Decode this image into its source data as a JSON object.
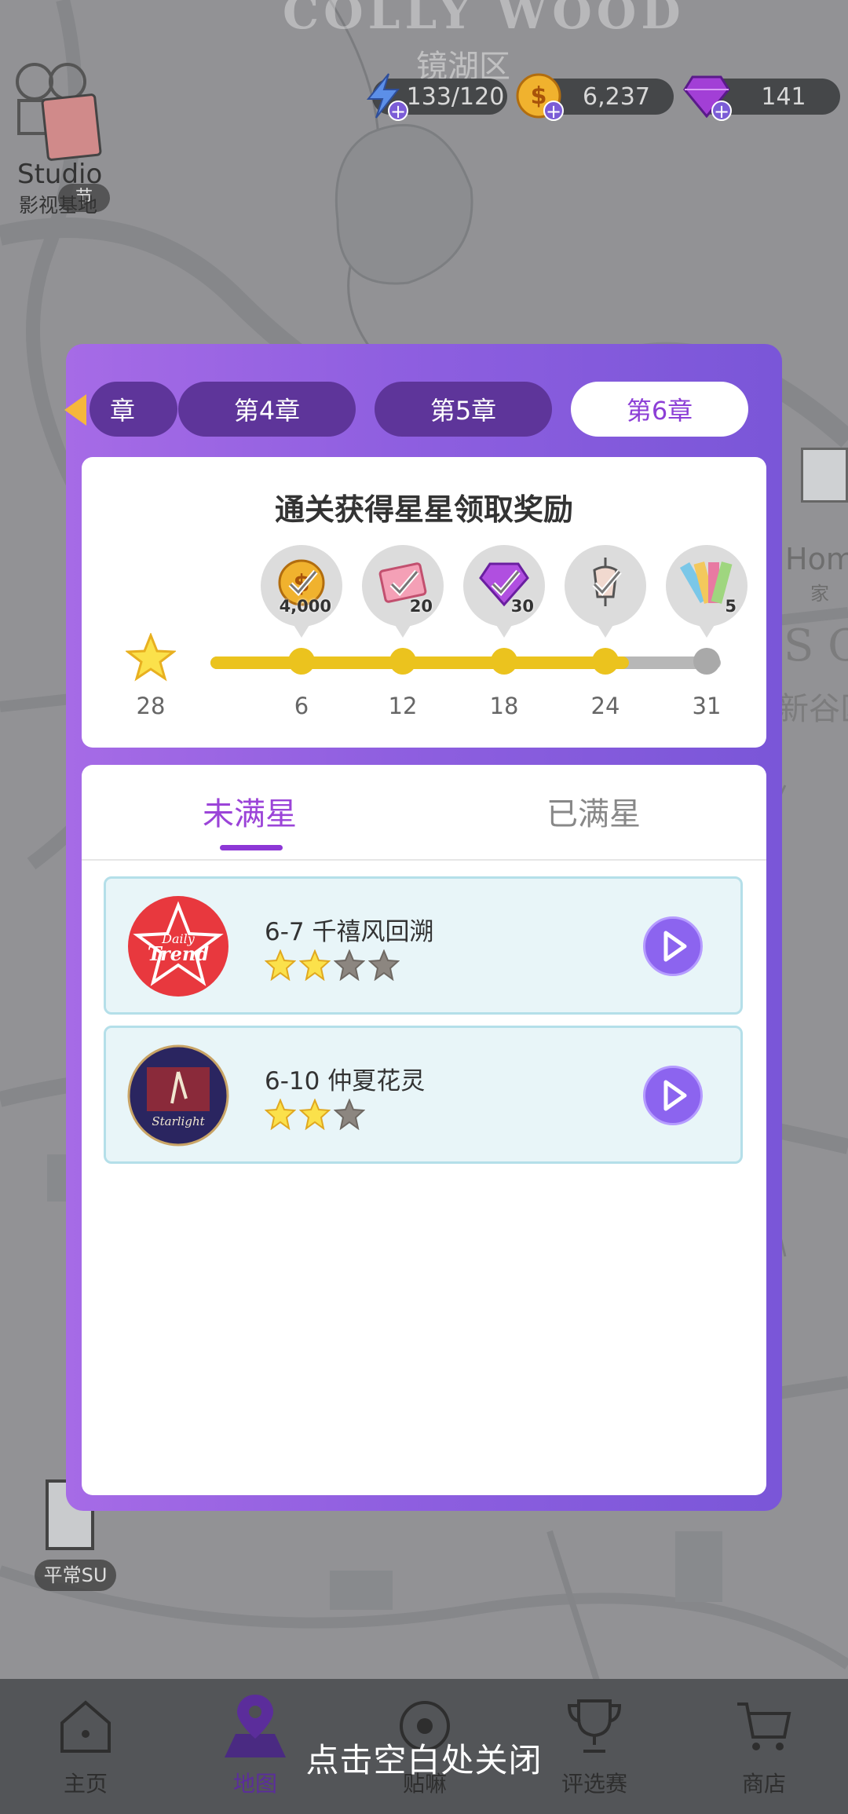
{
  "map": {
    "title": "COLLY WOOD",
    "district": "镜湖区",
    "right_home_label": "Home",
    "right_home_sub": "家",
    "right_city_label": "S CI",
    "right_city_sub": "新谷区",
    "studio_label": "Studio",
    "studio_sub": "影视基地",
    "studio_badge": "节",
    "su_label": "平常SU"
  },
  "resources": {
    "energy": "133/120",
    "coins": "6,237",
    "gems": "141",
    "energy_icon": "lightning-icon",
    "coin_icon": "coin-icon",
    "gem_icon": "gem-icon"
  },
  "modal": {
    "chapter_tabs": [
      {
        "label": "章",
        "active": false
      },
      {
        "label": "第4章",
        "active": false
      },
      {
        "label": "第5章",
        "active": false
      },
      {
        "label": "第6章",
        "active": true
      }
    ],
    "reward_title": "通关获得星星领取奖励",
    "total_stars": "28",
    "progress_fraction": 0.82,
    "milestones": [
      {
        "threshold": "6",
        "reward_icon": "coin-icon",
        "qty": "4,000",
        "reached": true
      },
      {
        "threshold": "12",
        "reward_icon": "ticket-icon",
        "qty": "20",
        "reached": true
      },
      {
        "threshold": "18",
        "reward_icon": "gem-icon",
        "qty": "30",
        "reached": true
      },
      {
        "threshold": "24",
        "reward_icon": "mannequin-icon",
        "qty": "",
        "reached": true
      },
      {
        "threshold": "31",
        "reward_icon": "color-palette-icon",
        "qty": "5",
        "reached": false
      }
    ],
    "list_tabs": {
      "not_full": "未满星",
      "full": "已满星"
    },
    "levels": [
      {
        "name": "6-7 千禧风回溯",
        "logo": "Daily Trend",
        "stars_earned": 2,
        "stars_total": 4
      },
      {
        "name": "6-10 仲夏花灵",
        "logo": "Starlight",
        "stars_earned": 2,
        "stars_total": 3
      }
    ]
  },
  "bottom_nav": {
    "items": [
      {
        "label": "主页",
        "icon": "home-icon"
      },
      {
        "label": "地图",
        "icon": "map-pin-icon"
      },
      {
        "label": "贴嘛",
        "icon": "post-icon"
      },
      {
        "label": "评选赛",
        "icon": "trophy-icon"
      },
      {
        "label": "商店",
        "icon": "cart-icon"
      }
    ],
    "close_hint": "点击空白处关闭"
  },
  "colors": {
    "modal_purple": "#8f5fe0",
    "active_tab_text": "#8c3ed6",
    "progress_gold": "#ebc31e",
    "play_button": "#8c64ef"
  }
}
